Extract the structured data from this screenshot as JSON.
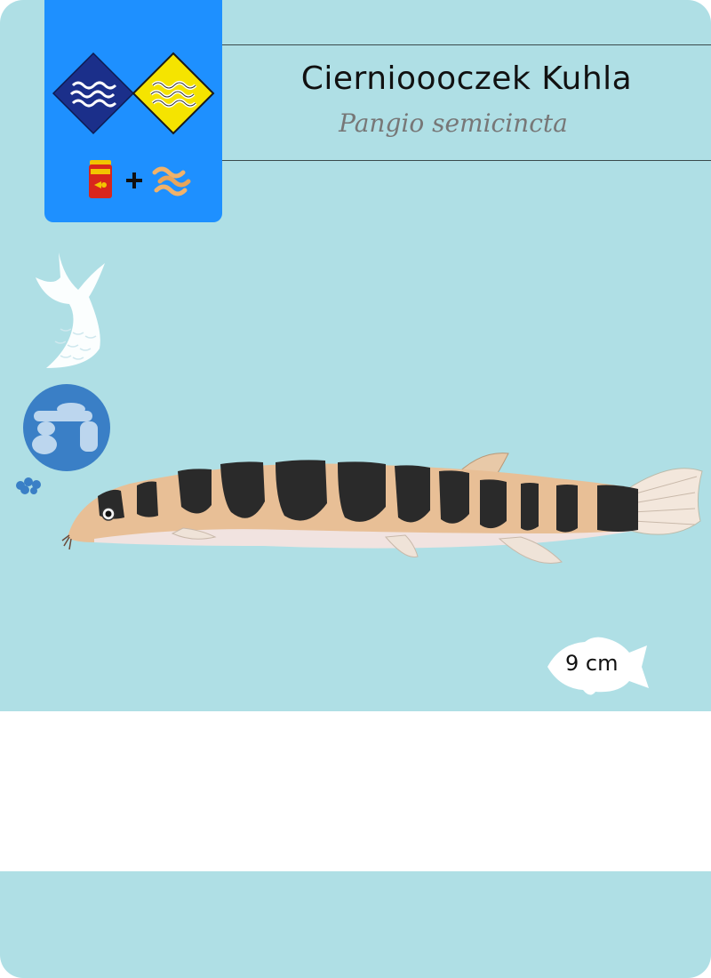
{
  "card": {
    "common_name": "Ciernioooczek Kuhla",
    "latin_name": "Pangio semicincta",
    "max_size": "9 cm"
  },
  "icons": {
    "water_top": "water-waves-diamond-icon",
    "water_bottom": "water-waves-diamond-icon",
    "food_flakes": "fish-food-can-icon",
    "food_live": "worms-icon",
    "swim_zone": "tail-fin-icon",
    "decor": "rocks-cave-icon",
    "eggs": "eggs-icon",
    "size": "fish-silhouette-icon"
  },
  "colors": {
    "card_bg": "#afdfe5",
    "panel_blue": "#1e90ff",
    "diamond_navy": "#1b2f8a",
    "diamond_yellow": "#f5e400",
    "icon_blue": "#3a7fc6"
  }
}
